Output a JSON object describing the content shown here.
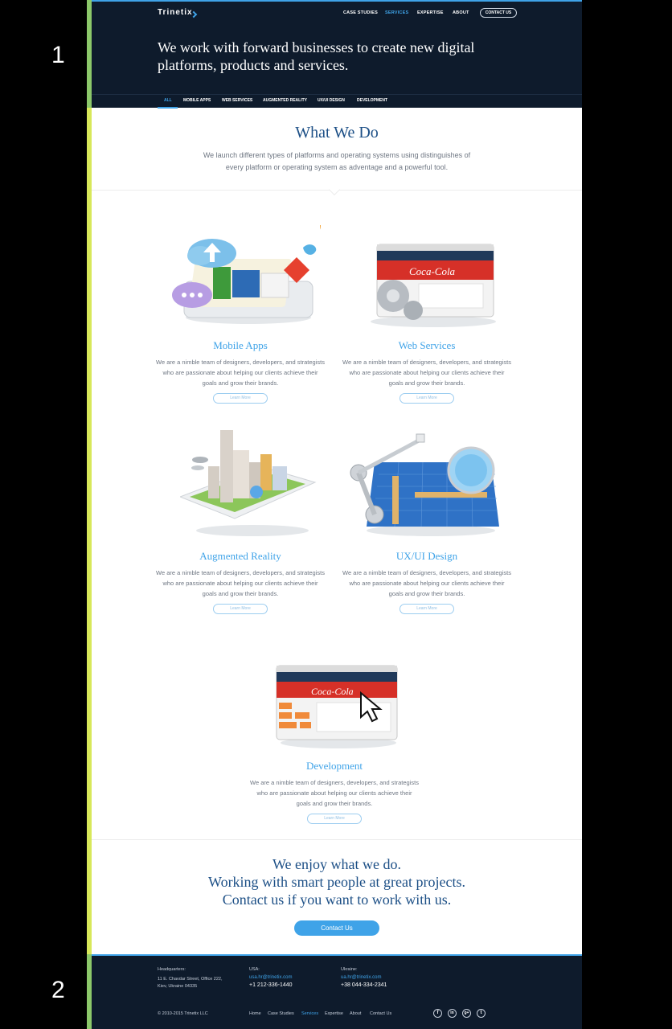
{
  "gutter": {
    "top_num": "1",
    "bottom_num": "2"
  },
  "header": {
    "logo": "Trinetix",
    "nav": [
      "CASE STUDIES",
      "SERVICES",
      "EXPERTISE",
      "ABOUT"
    ],
    "active_nav": "SERVICES",
    "contact_button": "CONTACT US",
    "hero_title": "We work with forward businesses to create new digital platforms, products and services.",
    "subnav": [
      "ALL",
      "MOBILE APPS",
      "WEB SERVICES",
      "AUGMENTED REALITY",
      "UX/UI DESIGN",
      "DEVELOPMENT"
    ],
    "active_subnav": "ALL"
  },
  "what_we_do": {
    "title": "What We Do",
    "description": "We launch different types of platforms and operating systems using distinguishes of every platform or operating system as adventage and a powerful tool."
  },
  "services": [
    {
      "title": "Mobile Apps",
      "desc": "We are a nimble team of designers, developers, and strategists who are passionate about helping our clients achieve their goals and grow their brands.",
      "button": "Learn More",
      "icon": "mobile-apps-illustration"
    },
    {
      "title": "Web Services",
      "desc": "We are a nimble team of designers, developers, and strategists who are passionate about helping our clients achieve their goals and grow their brands.",
      "button": "Learn More",
      "icon": "web-services-illustration"
    },
    {
      "title": "Augmented Reality",
      "desc": "We are a nimble team of designers, developers, and strategists who are passionate about helping our clients achieve their goals and grow their brands.",
      "button": "Learn More",
      "icon": "augmented-reality-illustration"
    },
    {
      "title": "UX/UI Design",
      "desc": "We are a nimble team of designers, developers, and strategists who are passionate about helping our clients achieve their goals and grow their brands.",
      "button": "Learn More",
      "icon": "ux-ui-illustration"
    },
    {
      "title": "Development",
      "desc": "We are a nimble team of designers, developers, and strategists who are passionate about helping our clients achieve their goals and grow their brands.",
      "button": "Learn More",
      "icon": "development-illustration"
    }
  ],
  "enjoy": {
    "line1": "We enjoy what we do.",
    "line2": "Working with smart people at great projects.",
    "line3": "Contact us if you want to work with us.",
    "button": "Contact Us"
  },
  "footer": {
    "hq_label": "Headquarters:",
    "hq_line1": "11 E. Chavdar Street, Office 222,",
    "hq_line2": "Kiev, Ukraine 04335",
    "usa_label": "USA:",
    "usa_email": "usa.hr@trinetix.com",
    "usa_phone": "+1 212-336-1440",
    "ua_label": "Ukraine:",
    "ua_email": "ua.hr@trinetix.com",
    "ua_phone": "+38 044-334-2341",
    "copyright": "© 2010-2015 Trinetix LLC",
    "nav": [
      "Home",
      "Case Studies",
      "Services",
      "Expertise",
      "About",
      "Contact Us"
    ],
    "active_nav": "Services",
    "social": [
      "f",
      "in",
      "g+",
      "t"
    ],
    "social_icons": [
      "facebook-icon",
      "linkedin-icon",
      "google-plus-icon",
      "twitter-icon"
    ]
  },
  "colors": {
    "accent": "#3fa3e8",
    "navy": "#0e1b2c",
    "heading": "#1c4f86"
  }
}
